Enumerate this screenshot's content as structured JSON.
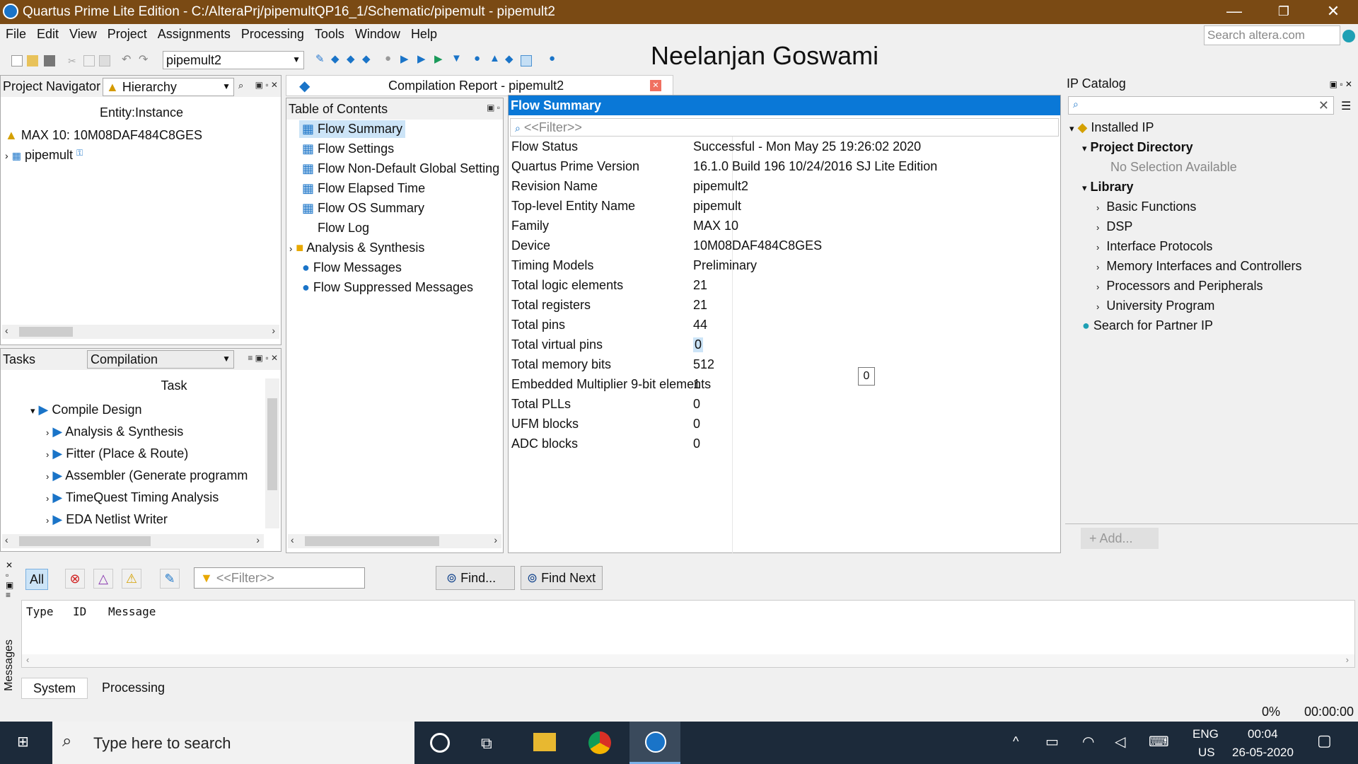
{
  "window": {
    "title": "Quartus Prime Lite Edition - C:/AlteraPrj/pipemultQP16_1/Schematic/pipemult - pipemult2",
    "minimize": "—",
    "restore": "❐",
    "close": "✕"
  },
  "menu": [
    "File",
    "Edit",
    "View",
    "Project",
    "Assignments",
    "Processing",
    "Tools",
    "Window",
    "Help"
  ],
  "search_altera": {
    "placeholder": "Search altera.com"
  },
  "toolbar": {
    "revision": "pipemult2"
  },
  "watermark": "Neelanjan Goswami",
  "project_navigator": {
    "title": "Project Navigator",
    "view": "Hierarchy",
    "column": "Entity:Instance",
    "device": "MAX 10: 10M08DAF484C8GES",
    "top_entity": "pipemult"
  },
  "tasks": {
    "title": "Tasks",
    "flow": "Compilation",
    "column": "Task",
    "items": [
      {
        "label": "Compile Design",
        "level": 0
      },
      {
        "label": "Analysis & Synthesis",
        "level": 1
      },
      {
        "label": "Fitter (Place & Route)",
        "level": 1
      },
      {
        "label": "Assembler (Generate programm",
        "level": 1
      },
      {
        "label": "TimeQuest Timing Analysis",
        "level": 1
      },
      {
        "label": "EDA Netlist Writer",
        "level": 1
      }
    ]
  },
  "report": {
    "tab_title": "Compilation Report - pipemult2",
    "toc_title": "Table of Contents",
    "toc": [
      {
        "label": "Flow Summary",
        "icon": "table-icon"
      },
      {
        "label": "Flow Settings",
        "icon": "table-icon"
      },
      {
        "label": "Flow Non-Default Global Setting",
        "icon": "table-icon"
      },
      {
        "label": "Flow Elapsed Time",
        "icon": "table-icon"
      },
      {
        "label": "Flow OS Summary",
        "icon": "table-icon"
      },
      {
        "label": "Flow Log",
        "icon": "none"
      },
      {
        "label": "Analysis & Synthesis",
        "icon": "folder-icon"
      },
      {
        "label": "Flow Messages",
        "icon": "info-icon"
      },
      {
        "label": "Flow Suppressed Messages",
        "icon": "info-icon"
      }
    ],
    "summary_title": "Flow Summary",
    "filter_placeholder": "<<Filter>>",
    "rows": [
      {
        "label": "Flow Status",
        "value": "Successful - Mon May 25 19:26:02 2020"
      },
      {
        "label": "Quartus Prime Version",
        "value": "16.1.0 Build 196 10/24/2016 SJ Lite Edition"
      },
      {
        "label": "Revision Name",
        "value": "pipemult2"
      },
      {
        "label": "Top-level Entity Name",
        "value": "pipemult"
      },
      {
        "label": "Family",
        "value": "MAX 10"
      },
      {
        "label": "Device",
        "value": "10M08DAF484C8GES"
      },
      {
        "label": "Timing Models",
        "value": "Preliminary"
      },
      {
        "label": "Total logic elements",
        "value": "21"
      },
      {
        "label": "Total registers",
        "value": "21"
      },
      {
        "label": "Total pins",
        "value": "44"
      },
      {
        "label": "Total virtual pins",
        "value": "0"
      },
      {
        "label": "Total memory bits",
        "value": "512"
      },
      {
        "label": "Embedded Multiplier 9-bit elements",
        "value": "1"
      },
      {
        "label": "Total PLLs",
        "value": "0"
      },
      {
        "label": "UFM blocks",
        "value": "0"
      },
      {
        "label": "ADC blocks",
        "value": "0"
      }
    ],
    "tooltip": "0"
  },
  "ip_catalog": {
    "title": "IP Catalog",
    "installed": "Installed IP",
    "project_dir": "Project Directory",
    "no_selection": "No Selection Available",
    "library": "Library",
    "library_items": [
      "Basic Functions",
      "DSP",
      "Interface Protocols",
      "Memory Interfaces and Controllers",
      "Processors and Peripherals",
      "University Program"
    ],
    "partner": "Search for Partner IP",
    "add": "+ Add..."
  },
  "messages": {
    "side_label": "Messages",
    "all": "All",
    "filter_placeholder": "<<Filter>>",
    "find": "Find...",
    "find_next": "Find Next",
    "columns": [
      "Type",
      "ID",
      "Message"
    ],
    "tabs": [
      "System",
      "Processing"
    ]
  },
  "status": {
    "progress": "0%",
    "time": "00:00:00"
  },
  "taskbar": {
    "search_placeholder": "Type here to search",
    "lang": "ENG",
    "region": "US",
    "time": "00:04",
    "date": "26-05-2020"
  },
  "colors": {
    "title_bar": "#7a4a14",
    "selection": "#0a78d7",
    "accent_blue": "#1a74c8",
    "taskbar": "#1c2a3a"
  }
}
